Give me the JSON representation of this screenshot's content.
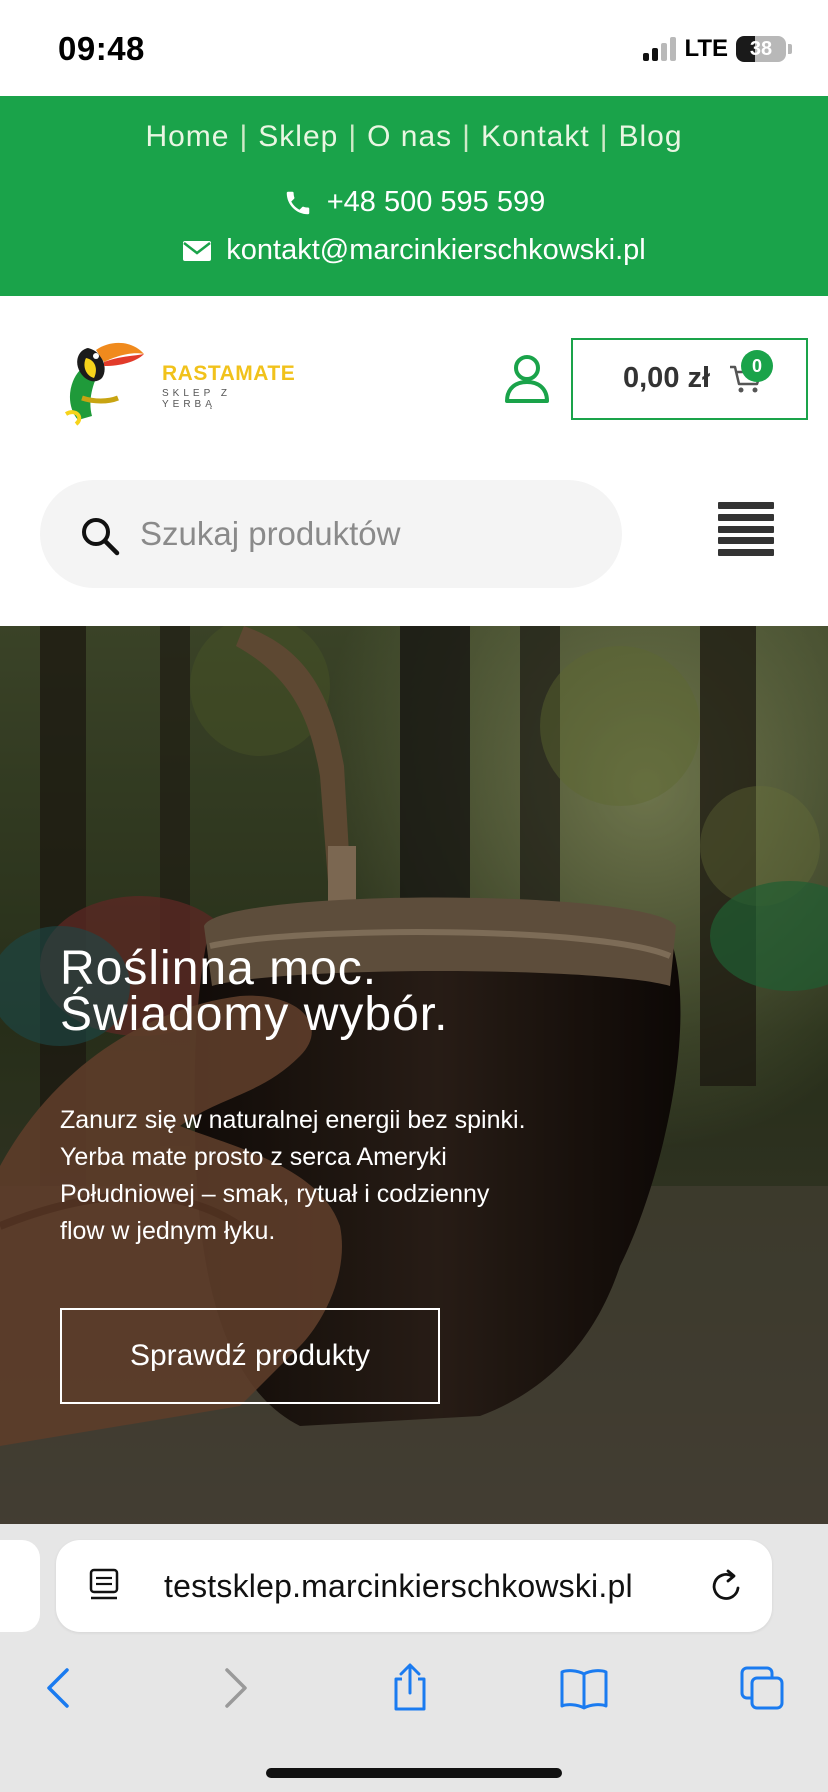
{
  "status_bar": {
    "time": "09:48",
    "network": "LTE",
    "battery": "38",
    "battery_level": 0.38
  },
  "top_nav": {
    "links": [
      "Home",
      "Sklep",
      "O nas",
      "Kontakt",
      "Blog"
    ],
    "separator": "|",
    "phone": "+48 500 595 599",
    "email": "kontakt@marcinkierschkowski.pl"
  },
  "header": {
    "logo_title": "RASTAMATE",
    "logo_subtitle": "SKLEP Z YERBĄ",
    "cart_total": "0,00 zł",
    "cart_count": "0",
    "search_placeholder": "Szukaj produktów"
  },
  "hero": {
    "title_line1": "Roślinna moc.",
    "title_line2": "Świadomy wybór.",
    "text": "Zanurz się w naturalnej energii bez spinki. Yerba mate prosto z serca Ameryki Południowej – smak, rytuał i codzienny flow w jednym łyku.",
    "cta": "Sprawdź produkty"
  },
  "browser": {
    "url": "testsklep.marcinkierschkowski.pl"
  },
  "colors": {
    "brand_green": "#1aa34a",
    "logo_yellow": "#f1c21b",
    "browser_blue": "#1a7bf0"
  },
  "icons": [
    "signal-icon",
    "battery-icon",
    "phone-icon",
    "mail-icon",
    "toucan-logo",
    "user-icon",
    "cart-icon",
    "search-icon",
    "hamburger-menu-icon",
    "page-info-icon",
    "reload-icon",
    "back-icon",
    "forward-icon",
    "share-icon",
    "bookmarks-icon",
    "tabs-icon"
  ]
}
